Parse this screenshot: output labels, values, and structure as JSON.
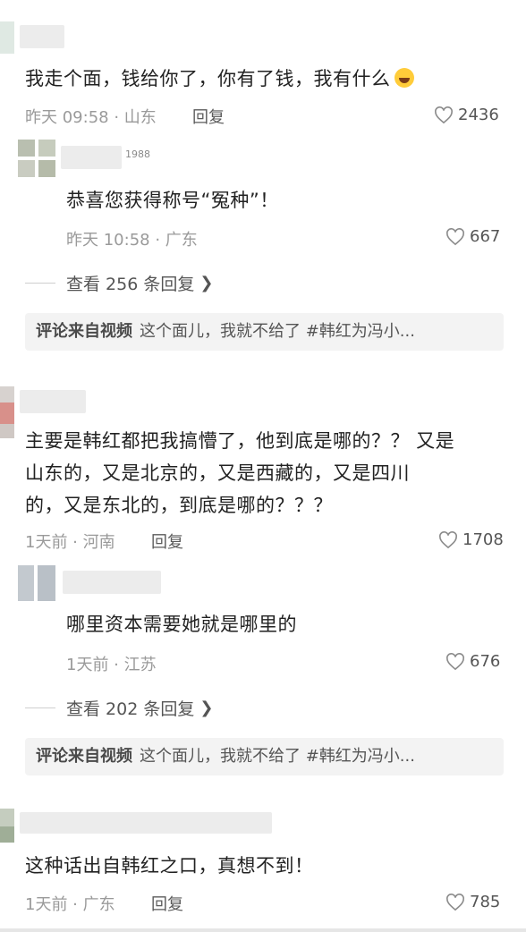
{
  "comments": [
    {
      "text": "我走个面，钱给你了，你有了钱，我有什么",
      "time_location": "昨天 09:58 · 山东",
      "reply_label": "回复",
      "likes": "2436",
      "emoji": "laughing-crying-emoji",
      "sub_reply": {
        "badge": "1988",
        "text": "恭喜您获得称号“冤种”！",
        "time_location": "昨天 10:58 · 广东",
        "likes": "667"
      },
      "expand_label": "查看 256 条回复",
      "source_label": "评论来自视频",
      "source_text": "这个面儿，我就不给了 #韩红为冯小..."
    },
    {
      "text_lines": [
        "主要是韩红都把我搞懵了，他到底是哪的？？ 又是",
        "山东的，又是北京的，又是西藏的，又是四川",
        "的，又是东北的，到底是哪的？？？"
      ],
      "time_location": "1天前 · 河南",
      "reply_label": "回复",
      "likes": "1708",
      "sub_reply": {
        "text": "哪里资本需要她就是哪里的",
        "time_location": "1天前 · 江苏",
        "likes": "676"
      },
      "expand_label": "查看 202 条回复",
      "source_label": "评论来自视频",
      "source_text": "这个面儿，我就不给了 #韩红为冯小..."
    },
    {
      "text": "这种话出自韩红之口，真想不到！",
      "time_location": "1天前 · 广东",
      "reply_label": "回复",
      "likes": "785"
    }
  ],
  "colors": {
    "text": "#222222",
    "meta": "#9a9a9a",
    "source_bg": "#f3f3f3",
    "heart": "#8c8c8c"
  },
  "icons": {
    "like": "heart-outline-icon",
    "expand": "chevron-right-icon"
  }
}
